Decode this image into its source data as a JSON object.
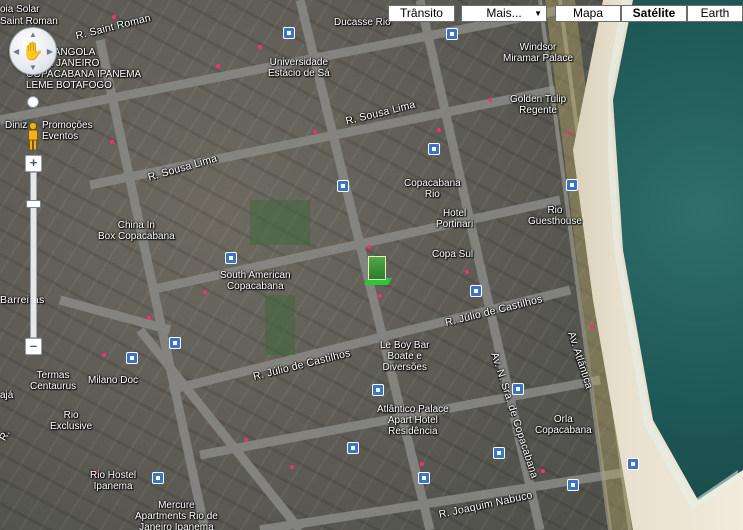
{
  "map_type_controls": {
    "traffic": "Trânsito",
    "more": "Mais...",
    "map": "Mapa",
    "satellite": "Satélite",
    "earth": "Earth",
    "selected": "satellite"
  },
  "zoom_controls": {
    "zoom_in": "+",
    "zoom_out": "–"
  },
  "labels": {
    "top_left_1": "oia Solar",
    "top_left_2": "Saint Roman",
    "district_1": "IEIRA ANGOLA",
    "district_2": "IO DE JANEIRO",
    "district_3": "COPACABANA IPANEMA",
    "district_4": "LEME BOTAFOGO",
    "ducasse": "Ducasse Rio",
    "universidade": "Universidade",
    "estacio": "Estácio de Sá",
    "sousa_lima_1": "R. Sousa Lima",
    "sousa_lima_2": "R. Sousa Lima",
    "saint_roman": "R. Saint Roman",
    "dinis": "Diniz",
    "promocoes": "Promoções",
    "eventos": "Eventos",
    "windsor_1": "Windsor",
    "windsor_2": "Miramar Palace",
    "golden_1": "Golden Tulip",
    "golden_2": "Regente",
    "copacabana_rio_1": "Copacabana",
    "copacabana_rio_2": "Rio",
    "portinari_1": "Hotel",
    "portinari_2": "Portinari",
    "rio_guest_1": "Rio",
    "rio_guest_2": "Guesthouse",
    "china_1": "China In",
    "china_2": "Box Copacabana",
    "south_american_1": "South American",
    "south_american_2": "Copacabana",
    "copa_sul": "Copa Sul",
    "julio_1": "R. Júlio de Castilhos",
    "julio_2": "R. Júlio de Castilhos",
    "barreiras": "Barreiras",
    "le_boy_1": "Le Boy Bar",
    "le_boy_2": "Boate e",
    "le_boy_3": "Diversões",
    "termas_1": "Termas",
    "termas_2": "Centaurus",
    "milano": "Milano Doc",
    "rio_exclusive_1": "Rio",
    "rio_exclusive_2": "Exclusive",
    "atlantico_1": "Atlântico Palace",
    "atlantico_2": "Apart Hotel",
    "atlantico_3": "Residência",
    "orla_1": "Orla",
    "orla_2": "Copacabana",
    "av_nsa": "Av. N. Sra. de Copacabana",
    "av_atlantica": "Av. Atlântica",
    "rio_hostel_1": "Rio Hostel",
    "rio_hostel_2": "Ipanema",
    "mercure_1": "Mercure",
    "mercure_2": "Apartments Rio de",
    "mercure_3": "Janeiro Ipanema",
    "joaquim": "R. Joaquim Nabuco",
    "aja": "ajá",
    "r_left": "R."
  }
}
